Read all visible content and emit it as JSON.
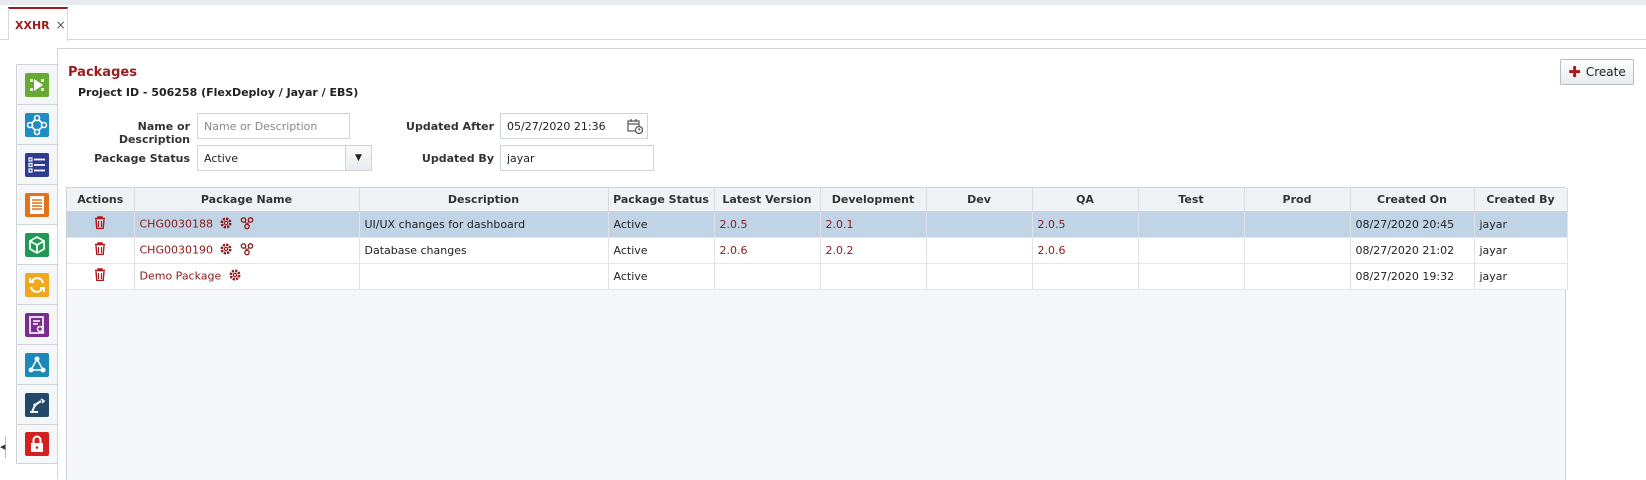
{
  "tab": {
    "label": "XXHR",
    "close": "×"
  },
  "sidebar": {
    "items": [
      {
        "icon": "play-icon",
        "color": "#6aa834"
      },
      {
        "icon": "network-icon",
        "color": "#1e8bc3"
      },
      {
        "icon": "checklist-icon",
        "color": "#2e3b8f"
      },
      {
        "icon": "document-icon",
        "color": "#e2731a"
      },
      {
        "icon": "package-icon",
        "color": "#1e9a55"
      },
      {
        "icon": "sync-icon",
        "color": "#f0a81c"
      },
      {
        "icon": "clipboard-icon",
        "color": "#7a2d8f"
      },
      {
        "icon": "share-icon",
        "color": "#1b88b7"
      },
      {
        "icon": "robot-arm-icon",
        "color": "#22496a"
      },
      {
        "icon": "lock-icon",
        "color": "#d42020"
      }
    ]
  },
  "header": {
    "title": "Packages",
    "subtitle": "Project ID - 506258 (FlexDeploy / Jayar / EBS)",
    "create_label": "Create"
  },
  "filters": {
    "name_label": "Name or Description",
    "name_placeholder": "Name or Description",
    "status_label": "Package Status",
    "status_value": "Active",
    "updated_after_label": "Updated After",
    "updated_after_value": "05/27/2020 21:36",
    "updated_by_label": "Updated By",
    "updated_by_value": "jayar"
  },
  "table": {
    "columns": [
      "Actions",
      "Package Name",
      "Description",
      "Package Status",
      "Latest Version",
      "Development",
      "Dev",
      "QA",
      "Test",
      "Prod",
      "Created On",
      "Created By"
    ],
    "rows": [
      {
        "name": "CHG0030188",
        "description": "UI/UX changes for dashboard",
        "status": "Active",
        "latest": "2.0.5",
        "development": "2.0.1",
        "dev": "",
        "qa": "2.0.5",
        "test": "",
        "prod": "",
        "created_on": "08/27/2020 20:45",
        "created_by": "jayar",
        "selected": true,
        "has_share": true
      },
      {
        "name": "CHG0030190",
        "description": "Database changes",
        "status": "Active",
        "latest": "2.0.6",
        "development": "2.0.2",
        "dev": "",
        "qa": "2.0.6",
        "test": "",
        "prod": "",
        "created_on": "08/27/2020 21:02",
        "created_by": "jayar",
        "selected": false,
        "has_share": true
      },
      {
        "name": "Demo Package",
        "description": "",
        "status": "Active",
        "latest": "",
        "development": "",
        "dev": "",
        "qa": "",
        "test": "",
        "prod": "",
        "created_on": "08/27/2020 19:32",
        "created_by": "jayar",
        "selected": false,
        "has_share": false
      }
    ]
  },
  "colors": {
    "accent": "#9b1c1c",
    "selected_row": "#c0d4e6"
  }
}
